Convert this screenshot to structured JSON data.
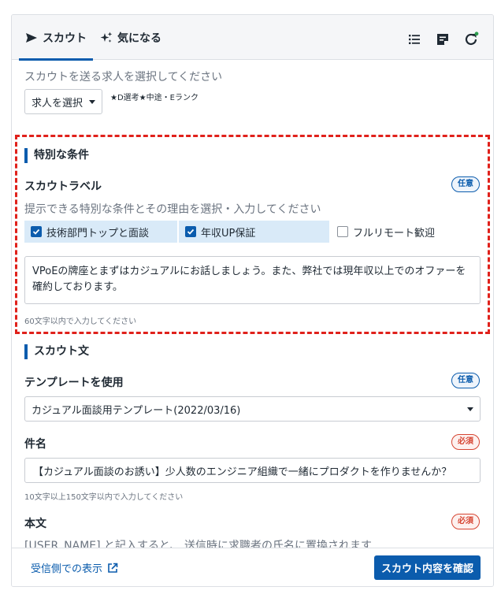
{
  "tabs": {
    "scout_label": "スカウト",
    "like_label": "気になる"
  },
  "toolbar": {
    "icons": [
      "list-icon",
      "note-icon",
      "refresh-icon"
    ],
    "notification_dot_color": "#2e9e4f"
  },
  "job_select": {
    "hint": "スカウトを送る求人を選択してください",
    "button_label": "求人を選択",
    "filter_note": "★D選考★中途・Eランク"
  },
  "special": {
    "section_title": "特別な条件",
    "label": "スカウトラベル",
    "badge": "任意",
    "hint": "提示できる特別な条件とその理由を選択・入力してください",
    "options": [
      {
        "label": "技術部門トップと面談",
        "checked": true
      },
      {
        "label": "年収UP保証",
        "checked": true
      },
      {
        "label": "フルリモート歓迎",
        "checked": false
      }
    ],
    "reason_text": "VPoEの牌座とまずはカジュアルにお話しましょう。また、弊社では現年収以上でのオファーを確約しております。",
    "limit_hint": "60文字以内で入力してください"
  },
  "scout_text": {
    "section_title": "スカウト文",
    "template_label": "テンプレートを使用",
    "template_badge": "任意",
    "template_value": "カジュアル面談用テンプレート(2022/03/16)",
    "subject_label": "件名",
    "subject_badge": "必須",
    "subject_value": "【カジュアル面談のお誘い】少人数のエンジニア組織で一緒にプロダクトを作りませんか？",
    "subject_hint": "10文字以上150文字以内で入力してください",
    "body_label": "本文",
    "body_badge": "必須",
    "body_hint": "[USER_NAME] と記入すると、 送信時に求職者の氏名に置換されます"
  },
  "footer": {
    "preview_link": "受信側での表示",
    "confirm_button": "スカウト内容を確認"
  },
  "colors": {
    "accent": "#0b5cad",
    "required": "#d64532",
    "highlight_border": "#e0211b",
    "chip_bg": "#d9eaf8"
  }
}
